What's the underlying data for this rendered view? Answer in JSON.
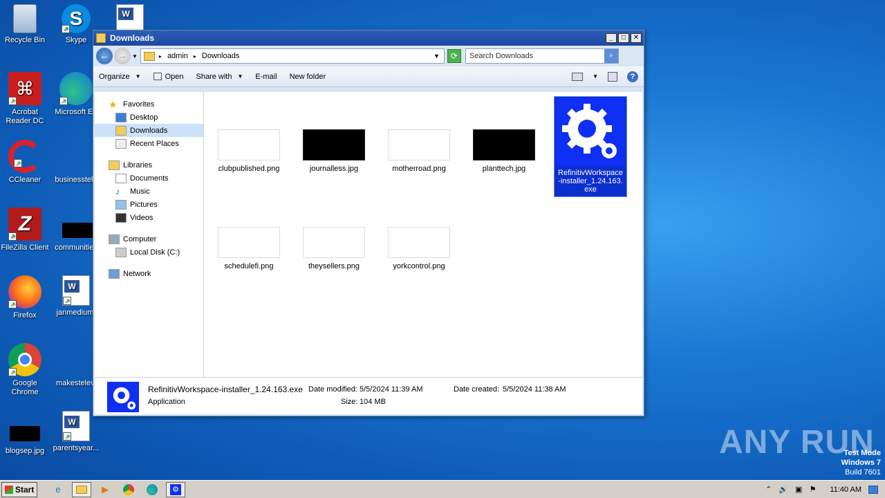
{
  "desktop": {
    "icons": [
      {
        "label": "Recycle Bin",
        "icon": "recycle-bin-icon"
      },
      {
        "label": "Skype",
        "icon": "skype-icon"
      },
      {
        "label": "Acrobat Reader DC",
        "icon": "acrobat-icon"
      },
      {
        "label": "Microsoft Ed",
        "icon": "edge-icon"
      },
      {
        "label": "CCleaner",
        "icon": "ccleaner-icon"
      },
      {
        "label": "businesstele",
        "icon": "file-icon"
      },
      {
        "label": "FileZilla Client",
        "icon": "filezilla-icon"
      },
      {
        "label": "communities",
        "icon": "file-icon"
      },
      {
        "label": "Firefox",
        "icon": "firefox-icon"
      },
      {
        "label": "janmedium.",
        "icon": "word-doc-icon"
      },
      {
        "label": "Google Chrome",
        "icon": "chrome-icon"
      },
      {
        "label": "makestelevi",
        "icon": "file-icon"
      },
      {
        "label": "blogsep.jpg",
        "icon": "image-icon"
      },
      {
        "label": "parentsyear...",
        "icon": "word-doc-icon"
      }
    ]
  },
  "watermark": "ANY RUN",
  "test_mode": {
    "line1": "Test Mode",
    "line2": "Windows 7",
    "line3": "Build 7601"
  },
  "window": {
    "title": "Downloads",
    "address": {
      "crumb1": "admin",
      "crumb2": "Downloads"
    },
    "search_placeholder": "Search Downloads",
    "toolbar": {
      "organize": "Organize",
      "open": "Open",
      "share_with": "Share with",
      "email": "E-mail",
      "new_folder": "New folder"
    },
    "nav": {
      "favorites": "Favorites",
      "desktop": "Desktop",
      "downloads": "Downloads",
      "recent_places": "Recent Places",
      "libraries": "Libraries",
      "documents": "Documents",
      "music": "Music",
      "pictures": "Pictures",
      "videos": "Videos",
      "computer": "Computer",
      "local_disk": "Local Disk (C:)",
      "network": "Network"
    },
    "files": [
      {
        "name": "clubpublished.png"
      },
      {
        "name": "journalless.jpg"
      },
      {
        "name": "motherroad.png"
      },
      {
        "name": "planttech.jpg"
      },
      {
        "name": "RefinitivWorkspace-installer_1.24.163.exe",
        "line1": "RefinitivWorkspace",
        "line2": "-installer_1.24.163.",
        "line3": "exe"
      },
      {
        "name": "schedulefi.png"
      },
      {
        "name": "theysellers.png"
      },
      {
        "name": "yorkcontrol.png"
      }
    ],
    "details": {
      "filename": "RefinitivWorkspace-installer_1.24.163.exe",
      "type": "Application",
      "modified_label": "Date modified:",
      "modified": "5/5/2024 11:39 AM",
      "created_label": "Date created:",
      "created": "5/5/2024 11:38 AM",
      "size_label": "Size:",
      "size": "104 MB"
    }
  },
  "taskbar": {
    "start": "Start",
    "clock": "11:40 AM"
  }
}
